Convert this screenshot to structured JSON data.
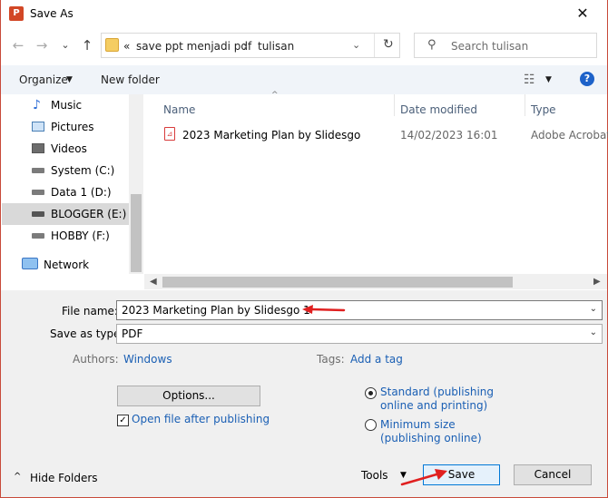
{
  "window": {
    "title": "Save As",
    "app_icon": "P"
  },
  "nav": {
    "back": "←",
    "forward": "→",
    "recent": "⌄",
    "up": "↑"
  },
  "address": {
    "overflow": "«",
    "path": [
      "save ppt menjadi pdf",
      "tulisan"
    ],
    "separator": "›",
    "refresh": "↻"
  },
  "search": {
    "placeholder": "Search tulisan"
  },
  "toolbar": {
    "organize": "Organize",
    "new_folder": "New folder",
    "help": "?"
  },
  "sidebar": {
    "items": [
      {
        "label": "Music",
        "icon": "music-icon"
      },
      {
        "label": "Pictures",
        "icon": "pictures-icon"
      },
      {
        "label": "Videos",
        "icon": "videos-icon"
      },
      {
        "label": "System (C:)",
        "icon": "drive-icon"
      },
      {
        "label": "Data 1 (D:)",
        "icon": "drive-icon"
      },
      {
        "label": "BLOGGER (E:)",
        "icon": "drive-icon",
        "selected": true
      },
      {
        "label": "HOBBY (F:)",
        "icon": "drive-icon"
      },
      {
        "label": "Network",
        "icon": "network-icon"
      }
    ]
  },
  "files": {
    "columns": [
      "Name",
      "Date modified",
      "Type"
    ],
    "rows": [
      {
        "name": "2023 Marketing Plan by Slidesgo",
        "date": "14/02/2023 16:01",
        "type": "Adobe Acrobat D"
      }
    ]
  },
  "form": {
    "file_name_label": "File name:",
    "file_name_value": "2023 Marketing Plan by Slidesgo 1",
    "save_type_label": "Save as type:",
    "save_type_value": "PDF",
    "authors_label": "Authors:",
    "authors_value": "Windows",
    "tags_label": "Tags:",
    "tags_value": "Add a tag",
    "options_button": "Options...",
    "open_after_label": "Open file after publishing",
    "open_after_checked": true,
    "optimize": [
      {
        "line1": "Standard (publishing",
        "line2": "online and printing)",
        "selected": true
      },
      {
        "line1": "Minimum size",
        "line2": "(publishing online)",
        "selected": false
      }
    ]
  },
  "footer": {
    "hide_folders": "Hide Folders",
    "tools": "Tools",
    "save": "Save",
    "cancel": "Cancel"
  },
  "colors": {
    "accent": "#0078d7",
    "link": "#1a5fb4",
    "annotation": "#e02020"
  }
}
